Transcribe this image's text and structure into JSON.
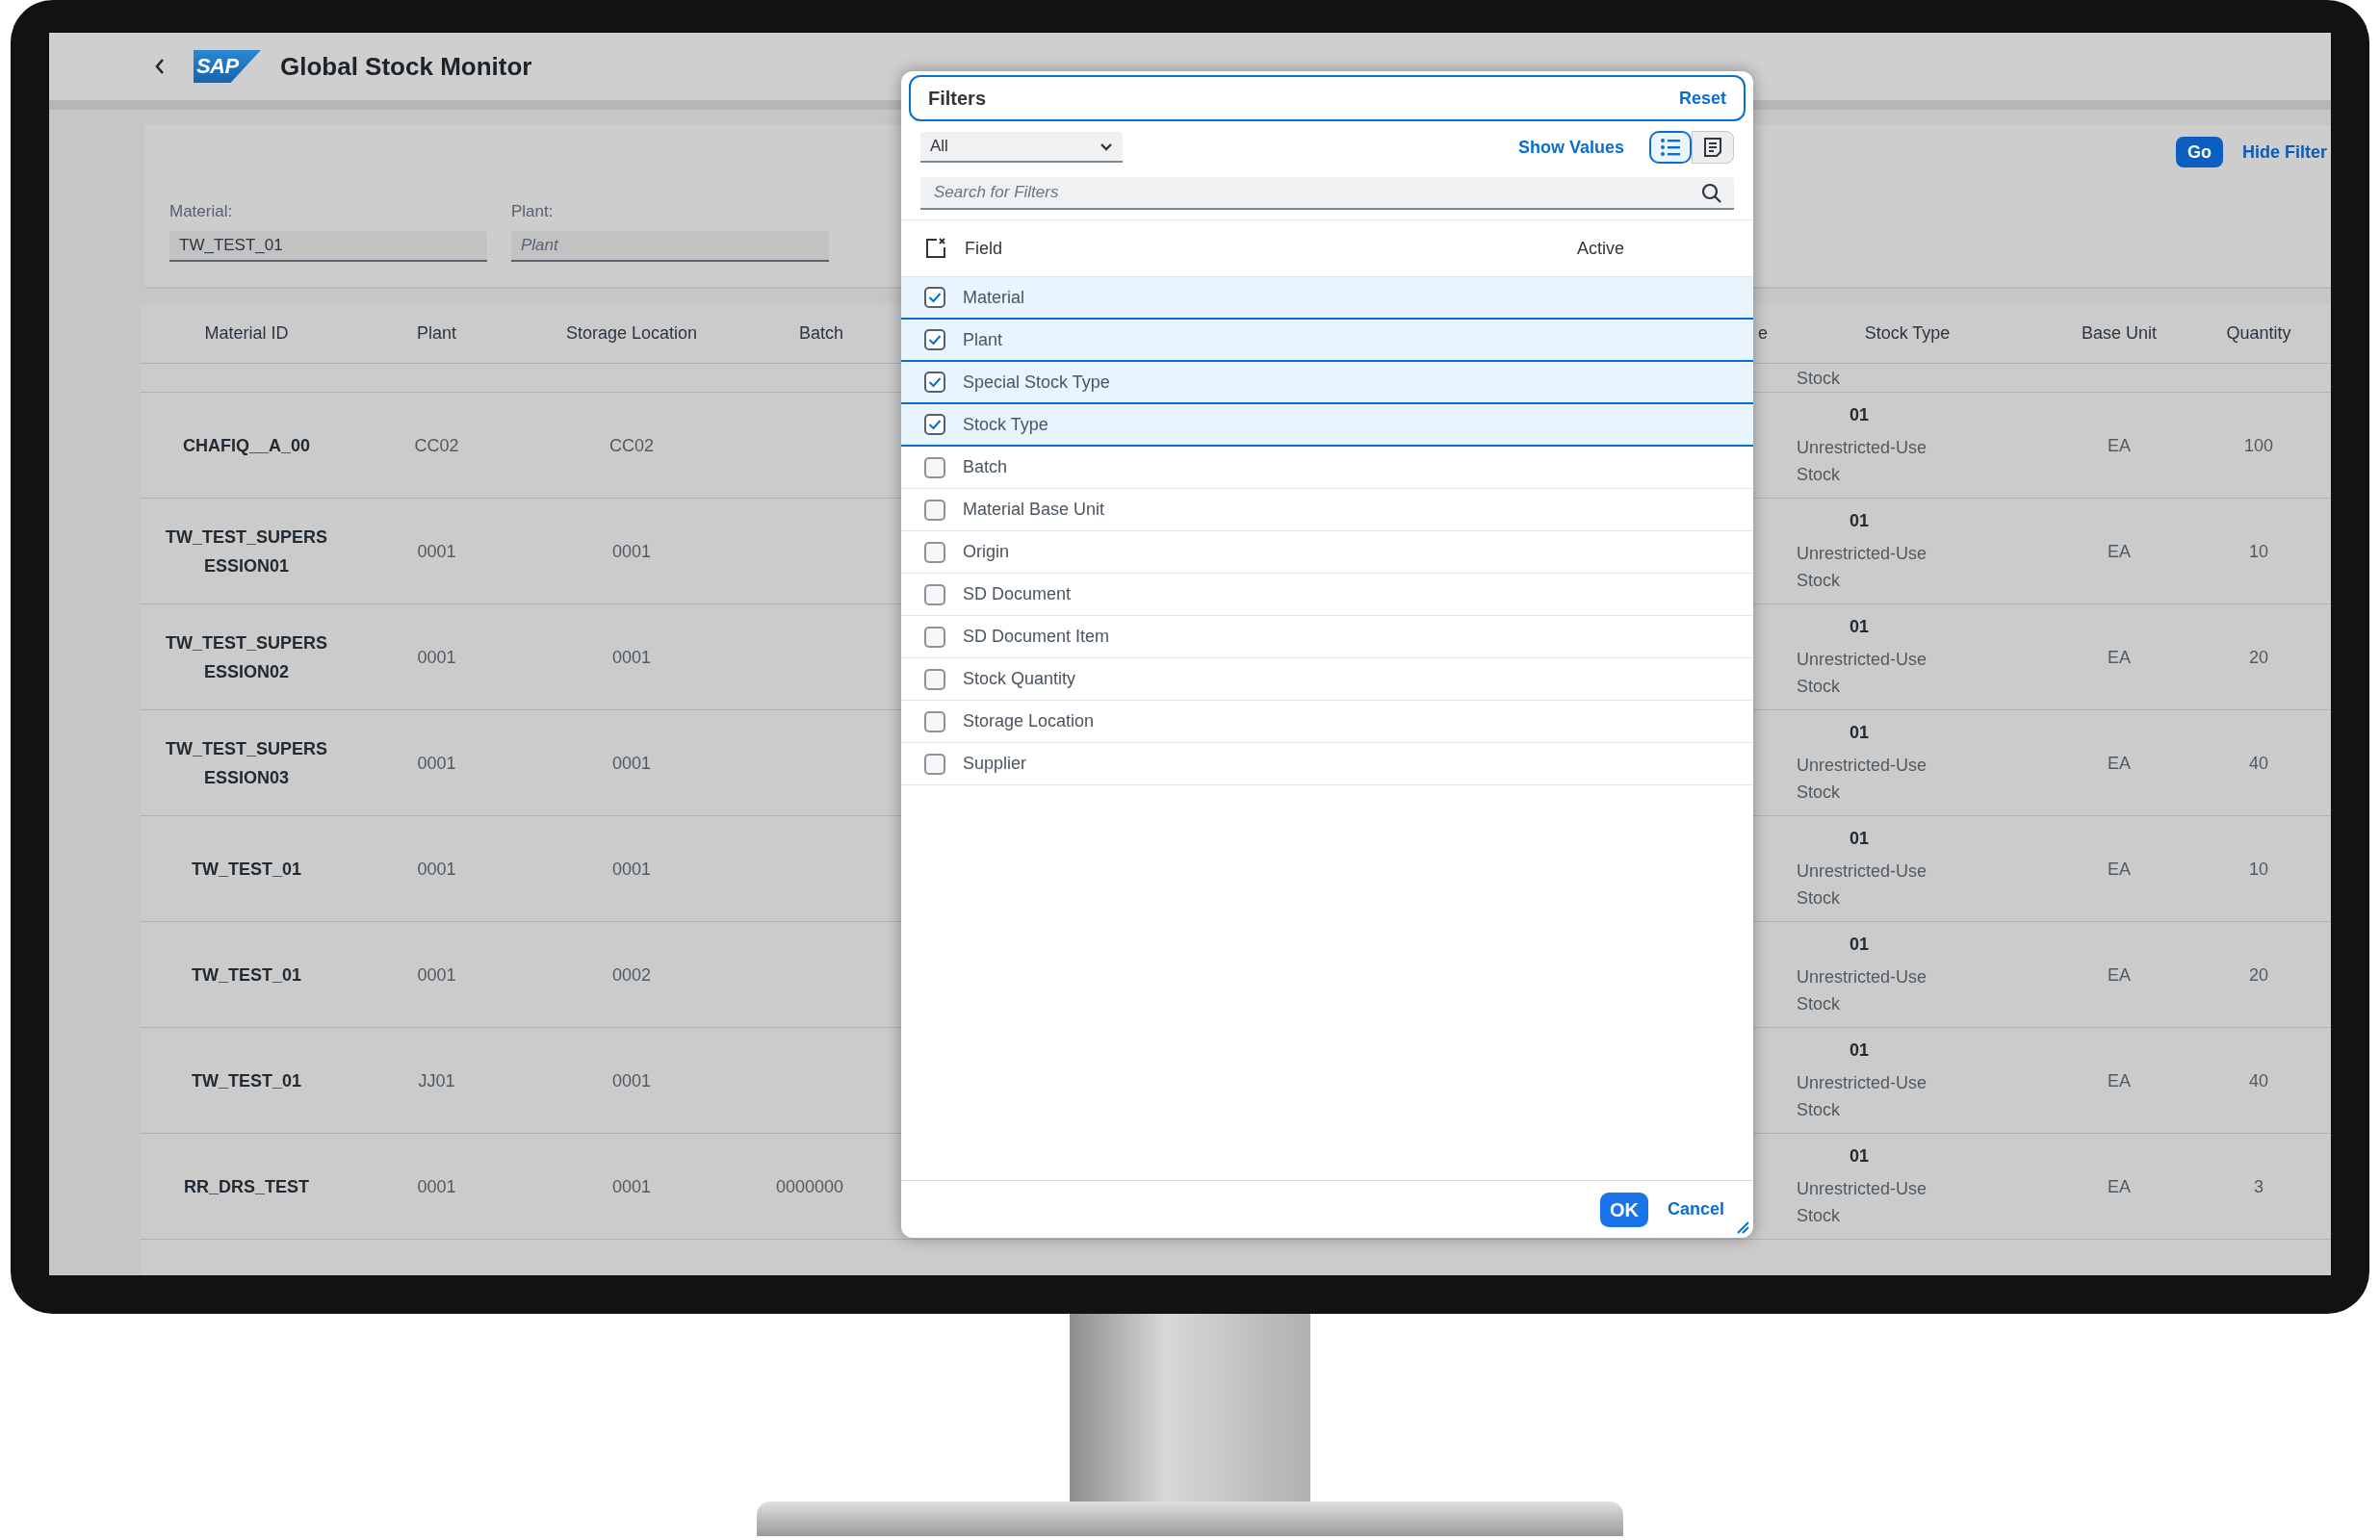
{
  "app": {
    "logo": "SAP",
    "title": "Global Stock Monitor"
  },
  "filter_bar": {
    "fields": [
      {
        "label": "Material:",
        "value": "TW_TEST_01"
      },
      {
        "label": "Plant:",
        "placeholder": "Plant"
      }
    ],
    "go_button": "Go",
    "hide_link": "Hide Filter"
  },
  "table": {
    "columns": [
      "Material ID",
      "Plant",
      "Storage Location",
      "Batch",
      "e",
      "Stock Type",
      "Base Unit",
      "Quantity"
    ],
    "rows": [
      {
        "stock_type_text": "Stock"
      },
      {
        "material_id": "CHAFIQ__A_00",
        "plant": "CC02",
        "storage_location": "CC02",
        "stock_type_code": "01",
        "stock_type_text": "Unrestricted-Use Stock",
        "base_unit": "EA",
        "quantity": "100"
      },
      {
        "material_id": "TW_TEST_SUPERSESSION01",
        "plant": "0001",
        "storage_location": "0001",
        "stock_type_code": "01",
        "stock_type_text": "Unrestricted-Use Stock",
        "base_unit": "EA",
        "quantity": "10"
      },
      {
        "material_id": "TW_TEST_SUPERSESSION02",
        "plant": "0001",
        "storage_location": "0001",
        "stock_type_code": "01",
        "stock_type_text": "Unrestricted-Use Stock",
        "base_unit": "EA",
        "quantity": "20"
      },
      {
        "material_id": "TW_TEST_SUPERSESSION03",
        "plant": "0001",
        "storage_location": "0001",
        "stock_type_code": "01",
        "stock_type_text": "Unrestricted-Use Stock",
        "base_unit": "EA",
        "quantity": "40"
      },
      {
        "material_id": "TW_TEST_01",
        "plant": "0001",
        "storage_location": "0001",
        "stock_type_code": "01",
        "stock_type_text": "Unrestricted-Use Stock",
        "base_unit": "EA",
        "quantity": "10"
      },
      {
        "material_id": "TW_TEST_01",
        "plant": "0001",
        "storage_location": "0002",
        "stock_type_code": "01",
        "stock_type_text": "Unrestricted-Use Stock",
        "base_unit": "EA",
        "quantity": "20"
      },
      {
        "material_id": "TW_TEST_01",
        "plant": "JJ01",
        "storage_location": "0001",
        "stock_type_code": "01",
        "stock_type_text": "Unrestricted-Use Stock",
        "base_unit": "EA",
        "quantity": "40"
      },
      {
        "material_id": "RR_DRS_TEST",
        "plant": "0001",
        "storage_location": "0001",
        "batch": "0000000",
        "stock_type_code": "01",
        "stock_type_text": "Unrestricted-Use Stock",
        "base_unit": "EA",
        "quantity": "3"
      }
    ]
  },
  "dialog": {
    "title": "Filters",
    "reset": "Reset",
    "select": "All",
    "show_values": "Show Values",
    "view_modes": [
      {
        "kind": "list",
        "selected": true
      },
      {
        "kind": "text",
        "selected": false
      }
    ],
    "search_placeholder": "Search for Filters",
    "column_field": "Field",
    "column_active": "Active",
    "fields": [
      {
        "label": "Material",
        "checked": true
      },
      {
        "label": "Plant",
        "checked": true
      },
      {
        "label": "Special Stock Type",
        "checked": true
      },
      {
        "label": "Stock Type",
        "checked": true
      },
      {
        "label": "Batch",
        "checked": false
      },
      {
        "label": "Material Base Unit",
        "checked": false
      },
      {
        "label": "Origin",
        "checked": false
      },
      {
        "label": "SD Document",
        "checked": false
      },
      {
        "label": "SD Document Item",
        "checked": false
      },
      {
        "label": "Stock Quantity",
        "checked": false
      },
      {
        "label": "Storage Location",
        "checked": false
      },
      {
        "label": "Supplier",
        "checked": false
      }
    ],
    "ok": "OK",
    "cancel": "Cancel"
  }
}
